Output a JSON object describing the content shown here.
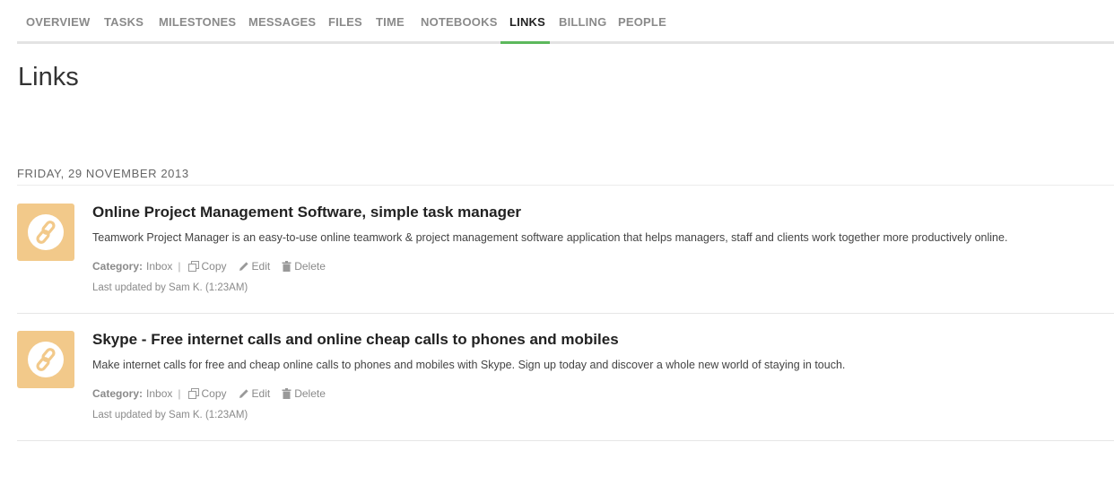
{
  "nav": {
    "tabs": [
      {
        "label": "OVERVIEW",
        "active": false
      },
      {
        "label": "TASKS",
        "active": false
      },
      {
        "label": "MILESTONES",
        "active": false
      },
      {
        "label": "MESSAGES",
        "active": false
      },
      {
        "label": "FILES",
        "active": false
      },
      {
        "label": "TIME",
        "active": false
      },
      {
        "label": "NOTEBOOKS",
        "active": false
      },
      {
        "label": "LINKS",
        "active": true
      },
      {
        "label": "BILLING",
        "active": false
      },
      {
        "label": "PEOPLE",
        "active": false
      }
    ],
    "active_color": "#5cb85c"
  },
  "page": {
    "title": "Links"
  },
  "groups": [
    {
      "date": "FRIDAY, 29 NOVEMBER 2013",
      "links": [
        {
          "title": "Online Project Management Software, simple task manager",
          "description": "Teamwork Project Manager is an easy-to-use online teamwork & project management software application that helps managers, staff and clients work together more productively online.",
          "category_label": "Category:",
          "category": "Inbox",
          "copy_label": "Copy",
          "edit_label": "Edit",
          "delete_label": "Delete",
          "updated": "Last updated by Sam K. (1:23AM)",
          "icon": "link-icon"
        },
        {
          "title": "Skype - Free internet calls and online cheap calls to phones and mobiles",
          "description": "Make internet calls for free and cheap online calls to phones and mobiles with Skype. Sign up today and discover a whole new world of staying in touch.",
          "category_label": "Category:",
          "category": "Inbox",
          "copy_label": "Copy",
          "edit_label": "Edit",
          "delete_label": "Delete",
          "updated": "Last updated by Sam K. (1:23AM)",
          "icon": "link-icon"
        }
      ]
    }
  ],
  "colors": {
    "thumb_bg": "#f2c98a",
    "link_icon": "#f2c98a"
  }
}
